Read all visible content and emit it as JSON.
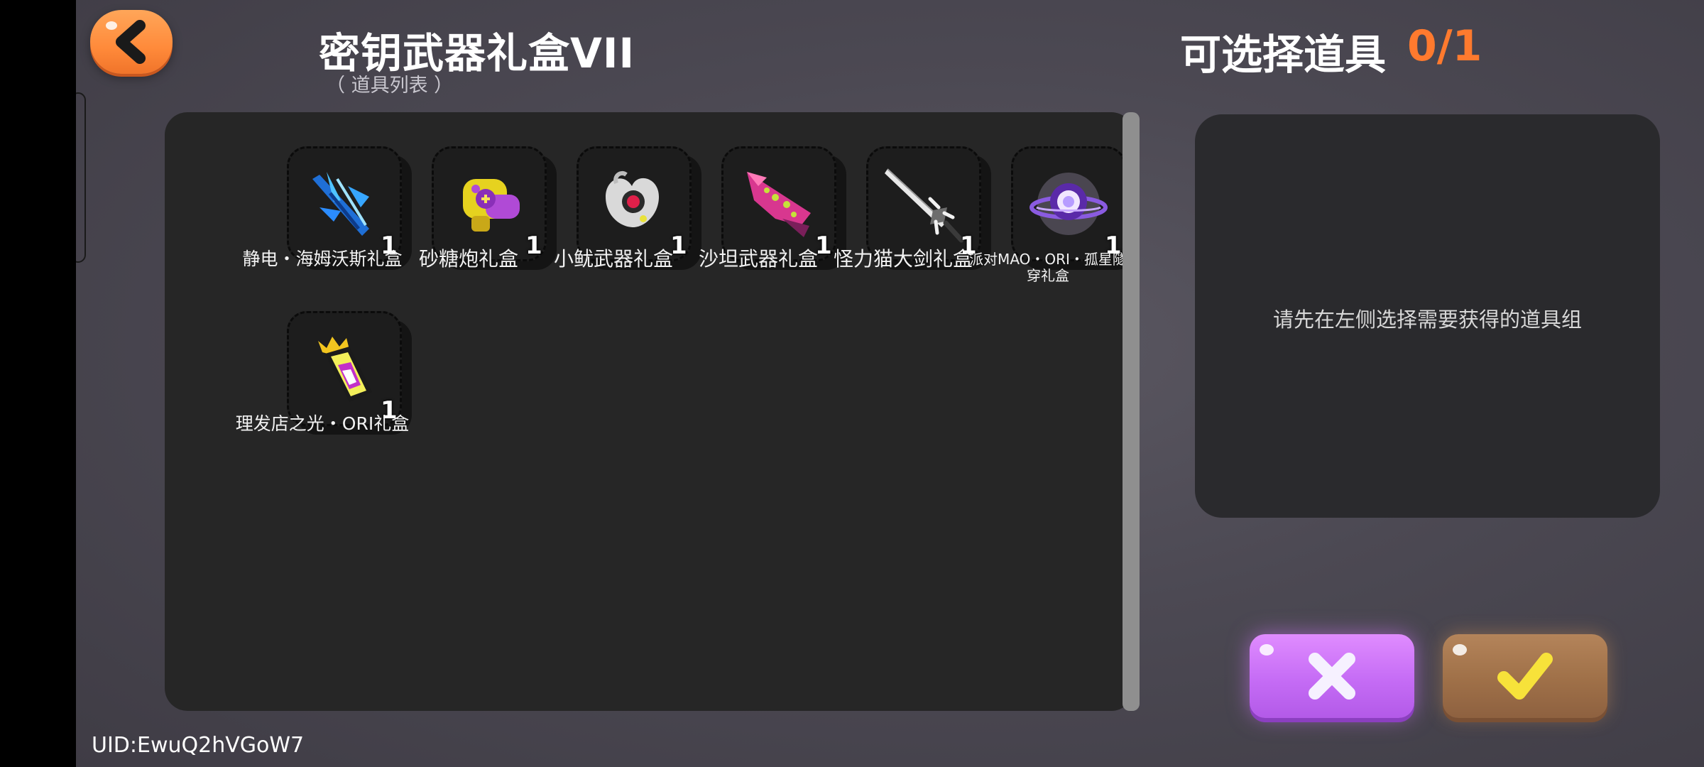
{
  "header": {
    "title": "密钥武器礼盒VII",
    "subtitle": "（ 道具列表 ）",
    "select_label": "可选择道具",
    "select_count": "0/1"
  },
  "items": [
    {
      "name": "静电・海姆沃斯礼盒",
      "qty": "1",
      "icon": "blue-trident-weapon-icon"
    },
    {
      "name": "砂糖炮礼盒",
      "qty": "1",
      "icon": "candy-cannon-weapon-icon"
    },
    {
      "name": "小鱿武器礼盒",
      "qty": "1",
      "icon": "squid-weapon-icon"
    },
    {
      "name": "沙坦武器礼盒",
      "qty": "1",
      "icon": "pink-claw-weapon-icon"
    },
    {
      "name": "怪力猫大剑礼盒",
      "qty": "1",
      "icon": "silver-greatsword-icon"
    },
    {
      "name": "派对MAO・ORI・孤星隧穿礼盒",
      "qty": "1",
      "icon": "planet-orb-weapon-icon"
    },
    {
      "name": "理发店之光・ORI礼盒",
      "qty": "1",
      "icon": "crown-canister-weapon-icon"
    }
  ],
  "info_panel": {
    "hint": "请先在左侧选择需要获得的道具组"
  },
  "buttons": {
    "cancel_icon": "x-icon",
    "confirm_icon": "check-icon"
  },
  "footer": {
    "uid": "UID:EwuQ2hVGoW7"
  },
  "colors": {
    "accent_orange": "#ff7a2e",
    "cancel_purple": "#c56cf5",
    "confirm_brown": "#9f7048",
    "panel_dark": "#262626"
  }
}
